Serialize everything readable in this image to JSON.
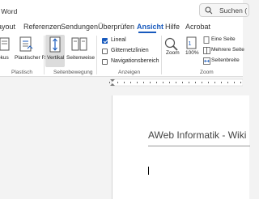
{
  "title_bar": {
    "doc_title": "- Word",
    "search_text": "Suchen ("
  },
  "tabs": [
    {
      "label": "ayout"
    },
    {
      "label": "Referenzen"
    },
    {
      "label": "Sendungen"
    },
    {
      "label": "Überprüfen"
    },
    {
      "label": "Ansicht"
    },
    {
      "label": "Hilfe"
    },
    {
      "label": "Acrobat"
    }
  ],
  "active_tab": "Ansicht",
  "ribbon": {
    "groups": {
      "plastisch": {
        "label": "Plastisch",
        "buttons": [
          "okus",
          "Plastischer Reader"
        ]
      },
      "seitenbewegung": {
        "label": "Seitenbewegung",
        "buttons": [
          "Vertikal",
          "Seitenweise"
        ]
      },
      "anzeigen": {
        "label": "Anzeigen",
        "checkboxes": [
          {
            "label": "Lineal",
            "checked": true
          },
          {
            "label": "Gitternetzlinien",
            "checked": false
          },
          {
            "label": "Navigationsbereich",
            "checked": false
          }
        ]
      },
      "zoom": {
        "label": "Zoom",
        "zoom_label": "Zoom",
        "percent_label": "100%",
        "page_buttons": [
          "Eine Seite",
          "Mehrere Seite",
          "Seitenbreite"
        ]
      }
    }
  },
  "document": {
    "heading": "AWeb Informatik - Wiki"
  },
  "colors": {
    "accent": "#185abd",
    "ribbon_bg": "#ffffff",
    "workspace_bg": "#f3f3f3"
  }
}
